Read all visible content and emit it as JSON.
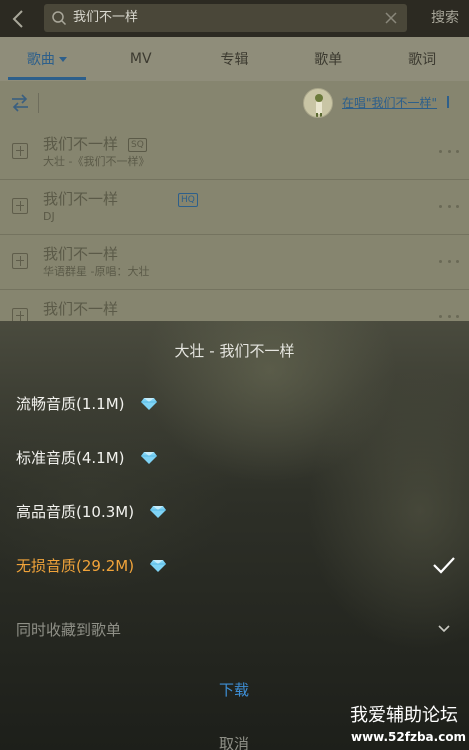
{
  "search": {
    "query": "我们不一样",
    "button_label": "搜索"
  },
  "tabs": [
    {
      "label": "歌曲"
    },
    {
      "label": "MV"
    },
    {
      "label": "专辑"
    },
    {
      "label": "歌单"
    },
    {
      "label": "歌词"
    }
  ],
  "now_playing": {
    "text": "在唱\"我们不一样\""
  },
  "songs": [
    {
      "title": "我们不一样",
      "badge": "SQ",
      "subtitle": "大壮 -《我们不一样》"
    },
    {
      "title": "我们不一样",
      "badge": "HQ",
      "subtitle": "DJ"
    },
    {
      "title": "我们不一样",
      "badge": "",
      "subtitle": "华语群星 -原唱：大壮"
    },
    {
      "title": "我们不一样",
      "badge": "",
      "subtitle": ""
    }
  ],
  "sheet": {
    "title": "大壮 - 我们不一样",
    "qualities": [
      {
        "label": "流畅音质(1.1M)",
        "selected": false
      },
      {
        "label": "标准音质(4.1M)",
        "selected": false
      },
      {
        "label": "高品音质(10.3M)",
        "selected": false
      },
      {
        "label": "无损音质(29.2M)",
        "selected": true
      }
    ],
    "collect_label": "同时收藏到歌单",
    "download_label": "下载",
    "cancel_label": "取消"
  },
  "watermark": {
    "line1": "我爱辅助论坛",
    "line2": "www.52fzba.com"
  },
  "colors": {
    "accent_blue": "#3e8fd6",
    "selected_orange": "#f0a33a",
    "diamond": "#7fd3f5"
  }
}
